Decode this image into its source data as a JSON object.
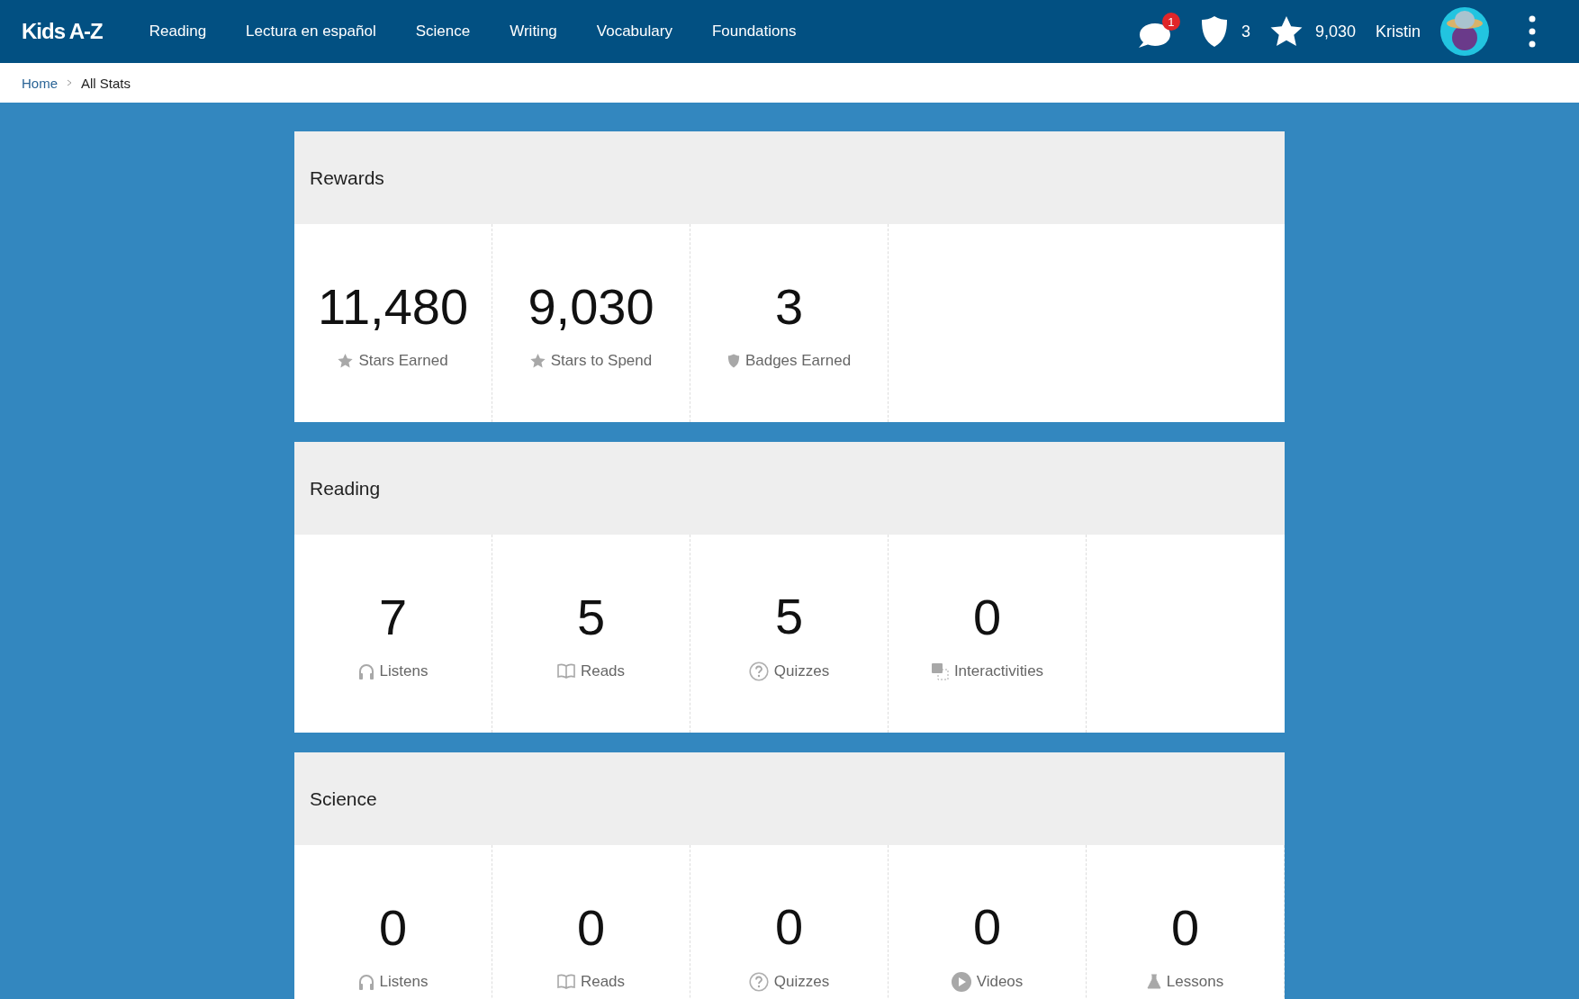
{
  "header": {
    "logo": "Kids A-Z",
    "nav": [
      {
        "label": "Reading"
      },
      {
        "label": "Lectura en español"
      },
      {
        "label": "Science"
      },
      {
        "label": "Writing"
      },
      {
        "label": "Vocabulary"
      },
      {
        "label": "Foundations"
      }
    ],
    "messages_badge": "1",
    "badges_count": "3",
    "stars_count": "9,030",
    "user_name": "Kristin"
  },
  "breadcrumb": [
    {
      "label": "Home",
      "kind": "link"
    },
    {
      "label": "All Stats",
      "kind": "current"
    }
  ],
  "sections": [
    {
      "title": "Rewards",
      "stats": [
        {
          "value": "11,480",
          "label": "Stars Earned",
          "kind": "star"
        },
        {
          "value": "9,030",
          "label": "Stars to Spend",
          "kind": "star"
        },
        {
          "value": "3",
          "label": "Badges Earned",
          "kind": "badge"
        }
      ]
    },
    {
      "title": "Reading",
      "stats": [
        {
          "value": "7",
          "label": "Listens",
          "kind": "listen"
        },
        {
          "value": "5",
          "label": "Reads",
          "kind": "read"
        },
        {
          "value": "5",
          "label": "Quizzes",
          "kind": "quiz"
        },
        {
          "value": "0",
          "label": "Interactivities",
          "kind": "interactive"
        }
      ]
    },
    {
      "title": "Science",
      "stats": [
        {
          "value": "0",
          "label": "Listens",
          "kind": "listen"
        },
        {
          "value": "0",
          "label": "Reads",
          "kind": "read"
        },
        {
          "value": "0",
          "label": "Quizzes",
          "kind": "quiz"
        },
        {
          "value": "0",
          "label": "Videos",
          "kind": "video"
        },
        {
          "value": "0",
          "label": "Lessons",
          "kind": "lesson"
        }
      ]
    }
  ]
}
